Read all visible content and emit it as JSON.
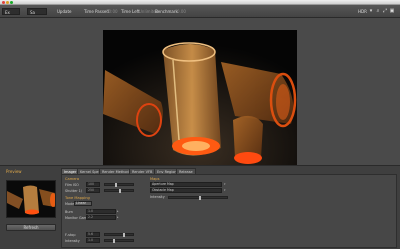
{
  "toolbar": {
    "field1_label": "Ex",
    "field2_label": "Sa",
    "update_label": "Update",
    "time_passed_label": "Time Passed",
    "time_passed_value": "00:00",
    "time_left_label": "Time Left",
    "time_left_value": "Unlimited",
    "benchmark_label": "Benchmark",
    "benchmark_value": "0.00",
    "hdr_label": "HDR"
  },
  "panel": {
    "preview_title": "Preview",
    "refresh_label": "Refresh",
    "tabs": [
      "Imager",
      "Kernel Spec",
      "Render Method",
      "Render VFB",
      "Env Region",
      "Release"
    ],
    "left": {
      "camera_title": "Camera",
      "film_iso_label": "Film ISO",
      "film_iso_value": "100",
      "shutter_label": "Shutter 1/",
      "shutter_value": "250",
      "tonemapping_title": "Tone Mapping",
      "mode_label": "Mode",
      "mode_value": "Linear",
      "burn_label": "Burn",
      "burn_value": "1.0",
      "gamma_label": "Monitor Gamma",
      "gamma_value": "2.2",
      "fstop_label": "F-stop",
      "fstop_value": "5.6",
      "intensity_label": "Intensity",
      "intensity_value": "1.0"
    },
    "right": {
      "maps_title": "Maps",
      "map1_label": "Aperture Map",
      "map2_label": "Obstacle Map",
      "intensity_label": "Intensity"
    }
  }
}
